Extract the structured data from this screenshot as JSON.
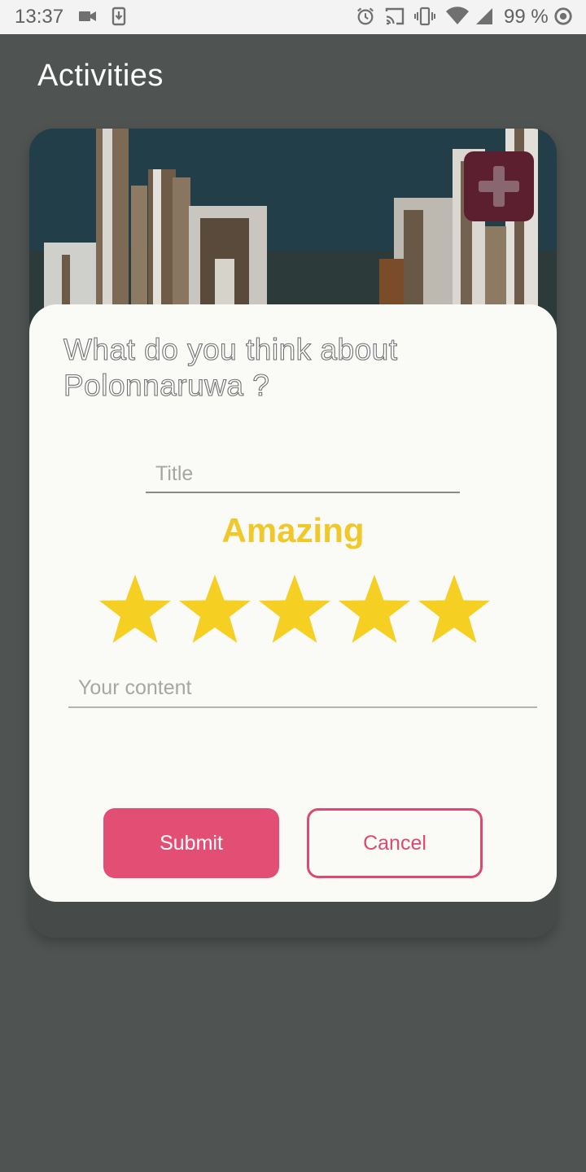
{
  "status_bar": {
    "time": "13:37",
    "battery": "99 %",
    "left_icons": [
      "video-camera-icon",
      "download-icon"
    ],
    "right_icons": [
      "alarm-icon",
      "cast-icon",
      "vibrate-icon",
      "wifi-icon",
      "signal-icon",
      "sync-icon"
    ]
  },
  "header": {
    "title": "Activities"
  },
  "card": {
    "image": "ruins-photo",
    "add_icon": "plus-icon",
    "add_button_color": "#5b1f30"
  },
  "dialog": {
    "question": "What do you think about Polonnaruwa ?",
    "title_placeholder": "Title",
    "title_value": "",
    "rating_label": "Amazing",
    "rating_value": 5,
    "rating_max": 5,
    "content_placeholder": "Your content",
    "content_value": "",
    "submit_label": "Submit",
    "cancel_label": "Cancel"
  },
  "colors": {
    "backdrop": "#4f5452",
    "dialog_bg": "#fafaf7",
    "accent": "#e24e74",
    "star": "#f5cf22"
  }
}
